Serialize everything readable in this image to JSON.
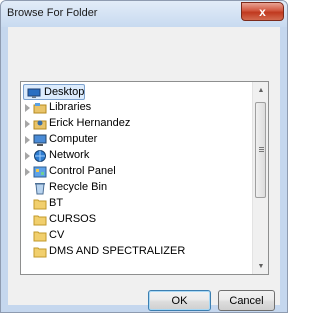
{
  "window": {
    "title": "Browse For Folder",
    "close_symbol": "x"
  },
  "tree": {
    "items": [
      {
        "label": "Desktop",
        "icon": "desktop-icon",
        "expandable": false,
        "selected": true
      },
      {
        "label": "Libraries",
        "icon": "libraries-icon",
        "expandable": true
      },
      {
        "label": "Erick Hernandez",
        "icon": "user-folder-icon",
        "expandable": true
      },
      {
        "label": "Computer",
        "icon": "computer-icon",
        "expandable": true
      },
      {
        "label": "Network",
        "icon": "network-icon",
        "expandable": true
      },
      {
        "label": "Control Panel",
        "icon": "control-panel-icon",
        "expandable": true
      },
      {
        "label": "Recycle Bin",
        "icon": "recycle-bin-icon",
        "expandable": false
      },
      {
        "label": "BT",
        "icon": "folder-icon",
        "expandable": false
      },
      {
        "label": "CURSOS",
        "icon": "folder-icon",
        "expandable": false
      },
      {
        "label": "CV",
        "icon": "folder-icon",
        "expandable": false
      },
      {
        "label": "DMS AND SPECTRALIZER",
        "icon": "folder-icon",
        "expandable": false
      }
    ]
  },
  "scrollbar": {
    "position": 0.0
  },
  "buttons": {
    "ok": "OK",
    "cancel": "Cancel"
  }
}
